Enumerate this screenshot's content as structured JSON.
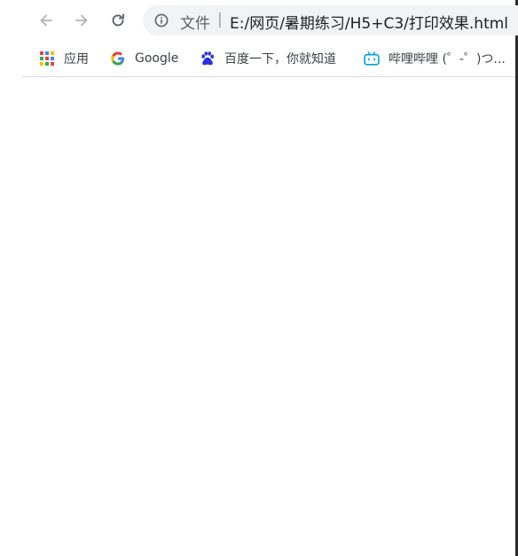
{
  "browser": {
    "address_bar": {
      "scheme_label": "文件",
      "separator": "|",
      "url": "E:/网页/暑期练习/H5+C3/打印效果.html"
    },
    "bookmarks": [
      {
        "label": "应用",
        "icon": "apps-grid-icon"
      },
      {
        "label": "Google",
        "icon": "google-icon"
      },
      {
        "label": "百度一下，你就知道",
        "icon": "baidu-paw-icon"
      },
      {
        "label": "哔哩哔哩 (゜-゜)つ...",
        "icon": "bilibili-tv-icon"
      }
    ]
  },
  "colors": {
    "toolbar_bg": "#ffffff",
    "omnibox_bg": "#f1f3f4",
    "icon_gray": "#5f6368",
    "text_dark": "#202124",
    "bilibili_blue": "#00a1d6",
    "baidu_blue": "#2932e1"
  }
}
